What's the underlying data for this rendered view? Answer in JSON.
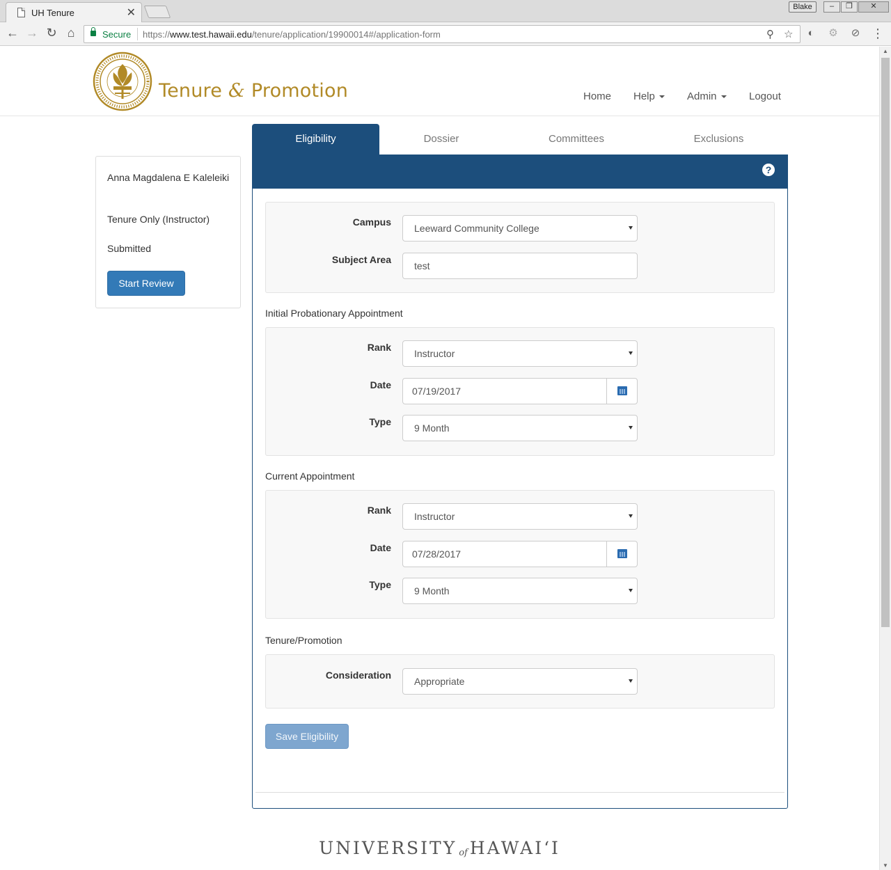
{
  "browser": {
    "tab_title": "UH Tenure",
    "tab_close": "✕",
    "profile": "Blake",
    "secure_label": "Secure",
    "url_scheme": "https://",
    "url_host": "www.test.hawaii.edu",
    "url_path": "/tenure/application/19900014#/application-form"
  },
  "header": {
    "title_part1": "Tenure ",
    "title_amp": "&",
    "title_part2": " Promotion",
    "nav": {
      "home": "Home",
      "help": "Help",
      "admin": "Admin",
      "logout": "Logout"
    }
  },
  "sidebar": {
    "name": "Anna Magdalena E Kaleleiki",
    "type": "Tenure Only (Instructor)",
    "status": "Submitted",
    "start_review": "Start Review"
  },
  "tabs": {
    "eligibility": "Eligibility",
    "dossier": "Dossier",
    "committees": "Committees",
    "exclusions": "Exclusions"
  },
  "form": {
    "campus_label": "Campus",
    "campus_value": "Leeward Community College",
    "subject_label": "Subject Area",
    "subject_value": "test",
    "initial": {
      "section": "Initial Probationary Appointment",
      "rank_label": "Rank",
      "rank_value": "Instructor",
      "date_label": "Date",
      "date_value": "07/19/2017",
      "type_label": "Type",
      "type_value": "9 Month"
    },
    "current": {
      "section": "Current Appointment",
      "rank_label": "Rank",
      "rank_value": "Instructor",
      "date_label": "Date",
      "date_value": "07/28/2017",
      "type_label": "Type",
      "type_value": "9 Month"
    },
    "tenure": {
      "section": "Tenure/Promotion",
      "consideration_label": "Consideration",
      "consideration_value": "Appropriate"
    },
    "save_label": "Save Eligibility"
  },
  "footer": {
    "word1": "UNIVERSITY",
    "word_of": "of",
    "word2": "HAWAIʻI"
  },
  "colors": {
    "primary": "#1c4e7c",
    "button_blue": "#337ab7",
    "brand_gold": "#b18a27"
  }
}
